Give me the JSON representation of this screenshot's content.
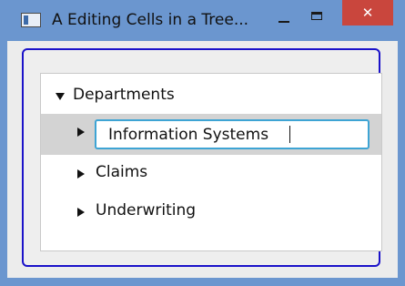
{
  "window": {
    "title": "A Editing Cells in a Tree...",
    "close_glyph": "✕",
    "icons": {
      "app": "app-window-icon",
      "minimize": "minimize-icon",
      "maximize": "maximize-icon",
      "close": "close-icon"
    }
  },
  "tree": {
    "root": {
      "label": "Departments",
      "expanded": true
    },
    "children": [
      {
        "label": "Information Systems",
        "expanded": false,
        "editing": true,
        "selected": true
      },
      {
        "label": "Claims",
        "expanded": false
      },
      {
        "label": "Underwriting",
        "expanded": false
      }
    ]
  }
}
